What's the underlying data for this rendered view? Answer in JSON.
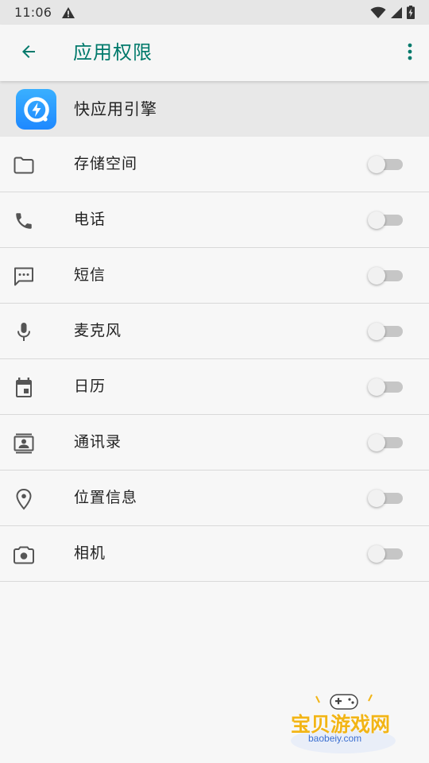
{
  "status_bar": {
    "time": "11:06",
    "icons": [
      "alert-triangle-icon",
      "wifi-icon",
      "cell-signal-icon",
      "battery-charging-icon"
    ]
  },
  "app_bar": {
    "title": "应用权限",
    "back_icon": "arrow-back-icon",
    "more_icon": "more-vert-icon",
    "accent_color": "#00796b"
  },
  "app_header": {
    "name": "快应用引擎",
    "icon": "quick-app-engine-icon"
  },
  "permissions": [
    {
      "label": "存储空间",
      "icon": "folder-icon",
      "enabled": false
    },
    {
      "label": "电话",
      "icon": "phone-icon",
      "enabled": false
    },
    {
      "label": "短信",
      "icon": "sms-icon",
      "enabled": false
    },
    {
      "label": "麦克风",
      "icon": "microphone-icon",
      "enabled": false
    },
    {
      "label": "日历",
      "icon": "calendar-icon",
      "enabled": false
    },
    {
      "label": "通讯录",
      "icon": "contacts-icon",
      "enabled": false
    },
    {
      "label": "位置信息",
      "icon": "location-icon",
      "enabled": false
    },
    {
      "label": "相机",
      "icon": "camera-icon",
      "enabled": false
    }
  ],
  "watermark": {
    "text": "宝贝游戏网",
    "url": "baobeiy.com"
  }
}
